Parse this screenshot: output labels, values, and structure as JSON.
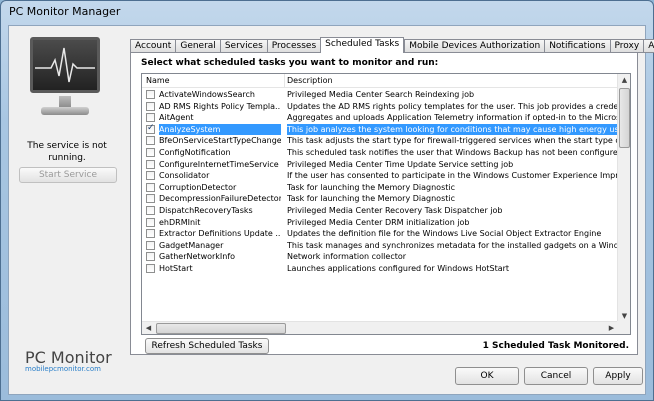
{
  "window": {
    "title": "PC Monitor Manager"
  },
  "left_panel": {
    "status": "The service is not running.",
    "start_button": "Start Service",
    "logo_text": "PC Monitor",
    "logo_url": "mobilepcmonitor.com"
  },
  "tabs": [
    {
      "label": "Account",
      "active": false
    },
    {
      "label": "General",
      "active": false
    },
    {
      "label": "Services",
      "active": false
    },
    {
      "label": "Processes",
      "active": false
    },
    {
      "label": "Scheduled Tasks",
      "active": true
    },
    {
      "label": "Mobile Devices Authorization",
      "active": false
    },
    {
      "label": "Notifications",
      "active": false
    },
    {
      "label": "Proxy",
      "active": false
    },
    {
      "label": "About",
      "active": false
    }
  ],
  "panel": {
    "heading": "Select what scheduled tasks you want to monitor and run:",
    "columns": {
      "name": "Name",
      "description": "Description"
    },
    "rows": [
      {
        "name": "ActivateWindowsSearch",
        "description": "Privileged Media Center Search Reindexing job",
        "checked": false,
        "selected": false
      },
      {
        "name": "AD RMS Rights Policy Templa...",
        "description": "Updates the AD RMS rights policy templates for the user. This job provides a credentia",
        "checked": false,
        "selected": false
      },
      {
        "name": "AitAgent",
        "description": "Aggregates and uploads Application Telemetry information if opted-in to the Microsoft C",
        "checked": false,
        "selected": false
      },
      {
        "name": "AnalyzeSystem",
        "description": "This job analyzes the system looking for conditions that may cause high energy use.",
        "checked": true,
        "selected": true
      },
      {
        "name": "BfeOnServiceStartTypeChange",
        "description": "This task adjusts the start type for firewall-triggered services when the start type of the",
        "checked": false,
        "selected": false
      },
      {
        "name": "ConfigNotification",
        "description": "This scheduled task notifies the user that Windows Backup has not been configured.",
        "checked": false,
        "selected": false
      },
      {
        "name": "ConfigureInternetTimeService",
        "description": "Privileged Media Center Time Update Service setting job",
        "checked": false,
        "selected": false
      },
      {
        "name": "Consolidator",
        "description": "If the user has consented to participate in the Windows Customer Experience Improve",
        "checked": false,
        "selected": false
      },
      {
        "name": "CorruptionDetector",
        "description": "Task for launching the Memory Diagnostic",
        "checked": false,
        "selected": false
      },
      {
        "name": "DecompressionFailureDetector",
        "description": "Task for launching the Memory Diagnostic",
        "checked": false,
        "selected": false
      },
      {
        "name": "DispatchRecoveryTasks",
        "description": "Privileged Media Center Recovery Task Dispatcher job",
        "checked": false,
        "selected": false
      },
      {
        "name": "ehDRMInit",
        "description": "Privileged Media Center DRM initialization job",
        "checked": false,
        "selected": false
      },
      {
        "name": "Extractor Definitions Update ...",
        "description": "Updates the definition file for the Windows Live Social Object Extractor Engine",
        "checked": false,
        "selected": false
      },
      {
        "name": "GadgetManager",
        "description": "This task manages and synchronizes metadata for the installed gadgets on a Windows",
        "checked": false,
        "selected": false
      },
      {
        "name": "GatherNetworkInfo",
        "description": "Network information collector",
        "checked": false,
        "selected": false
      },
      {
        "name": "HotStart",
        "description": "Launches applications configured for Windows HotStart",
        "checked": false,
        "selected": false
      }
    ],
    "refresh_button": "Refresh Scheduled Tasks",
    "monitored_text": "1 Scheduled Task Monitored."
  },
  "footer": {
    "ok": "OK",
    "cancel": "Cancel",
    "apply": "Apply"
  }
}
